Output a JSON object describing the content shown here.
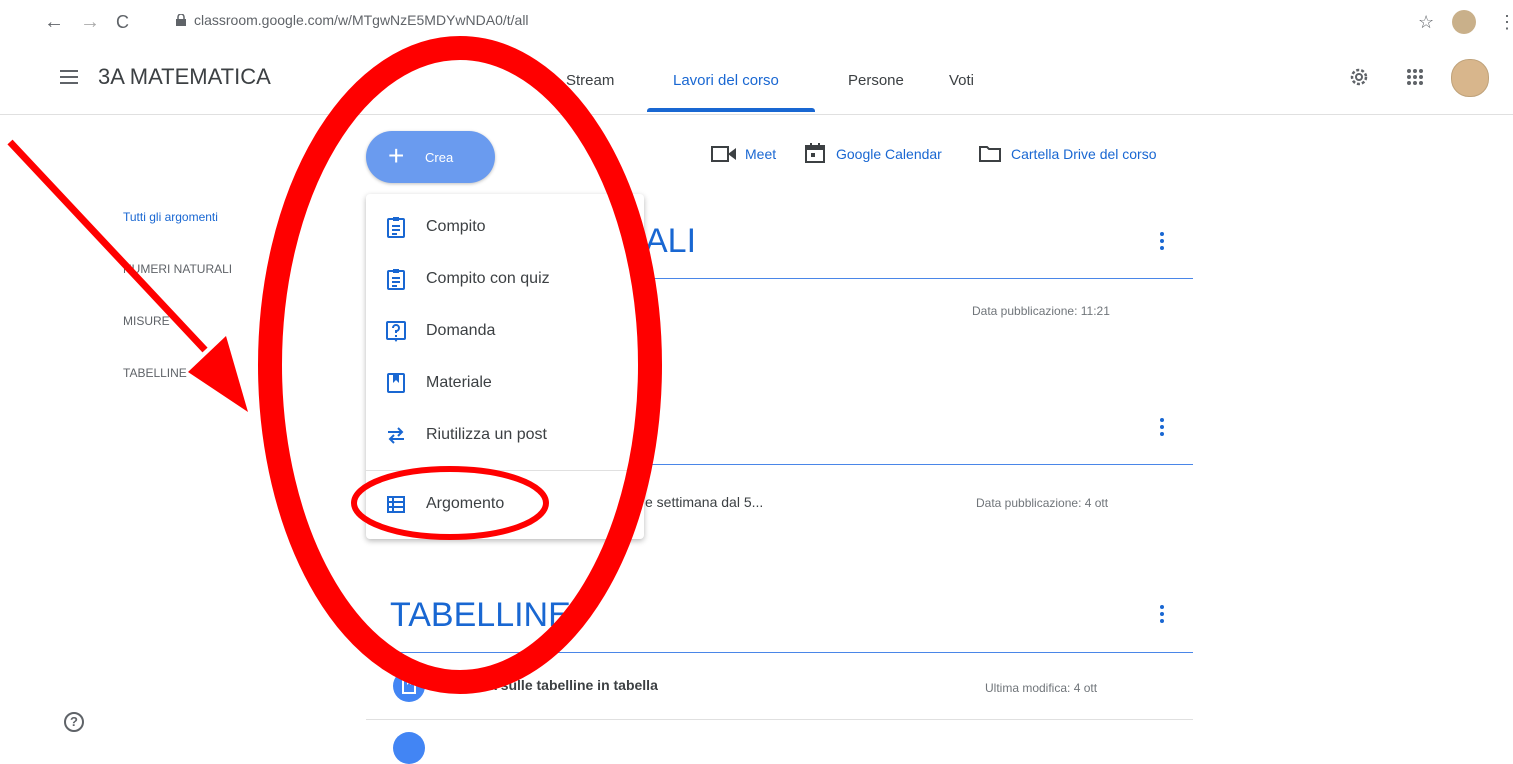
{
  "browser": {
    "url": "classroom.google.com/w/MTgwNzE5MDYwNDA0/t/all",
    "back_glyph": "←",
    "forward_glyph": "→",
    "reload_glyph": "C",
    "star_glyph": "☆",
    "menu_glyph": "⋮"
  },
  "header": {
    "class_name": "3A MATEMATICA",
    "tabs": [
      {
        "label": "Stream"
      },
      {
        "label": "Lavori del corso",
        "active": true
      },
      {
        "label": "Persone"
      },
      {
        "label": "Voti"
      }
    ]
  },
  "sidebar": {
    "topics": [
      {
        "label": "Tutti gli argomenti",
        "active": true
      },
      {
        "label": "NUMERI NATURALI"
      },
      {
        "label": "MISURE"
      },
      {
        "label": "TABELLINE"
      }
    ]
  },
  "toolbar": {
    "create_label": "Crea",
    "meet_label": "Meet",
    "calendar_label": "Google Calendar",
    "drive_label": "Cartella Drive del corso"
  },
  "create_menu": {
    "items": [
      {
        "label": "Compito",
        "icon": "assignment-icon"
      },
      {
        "label": "Compito con quiz",
        "icon": "quiz-icon"
      },
      {
        "label": "Domanda",
        "icon": "question-icon"
      },
      {
        "label": "Materiale",
        "icon": "material-icon"
      },
      {
        "label": "Riutilizza un post",
        "icon": "reuse-icon"
      },
      {
        "label": "Argomento",
        "icon": "topic-icon"
      }
    ]
  },
  "sections": [
    {
      "title_fragment": "ALI",
      "meta": "Data pubblicazione: 11:21"
    },
    {
      "item_fragment": "e settimana dal 5...",
      "meta": "Data pubblicazione: 4 ott"
    },
    {
      "title": "TABELLINE",
      "items": [
        {
          "title": "Verifica sulle tabelline in tabella",
          "meta": "Ultima modifica: 4 ott"
        }
      ]
    }
  ],
  "colors": {
    "accent": "#1967d2",
    "create_button": "#6a9bef",
    "annotation": "#ff0000"
  }
}
